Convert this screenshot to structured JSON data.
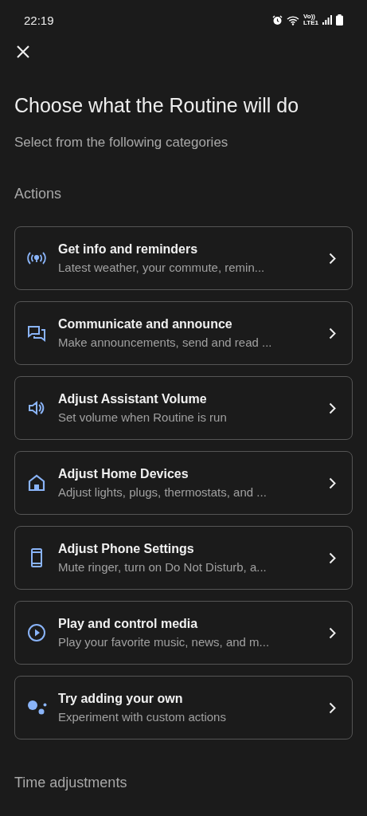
{
  "status_bar": {
    "time": "22:19",
    "network_top": "Vo))",
    "network_bottom": "LTE1"
  },
  "title": "Choose what the Routine will do",
  "subtitle": "Select from the following categories",
  "sections": [
    {
      "heading": "Actions",
      "items": [
        {
          "kind": "info",
          "title": "Get info and reminders",
          "subtitle": "Latest weather, your commute, remin..."
        },
        {
          "kind": "chat",
          "title": "Communicate and announce",
          "subtitle": "Make announcements, send and read ..."
        },
        {
          "kind": "volume",
          "title": "Adjust Assistant Volume",
          "subtitle": "Set volume when Routine is run"
        },
        {
          "kind": "home",
          "title": "Adjust Home Devices",
          "subtitle": "Adjust lights, plugs, thermostats, and ..."
        },
        {
          "kind": "phone",
          "title": "Adjust Phone Settings",
          "subtitle": "Mute ringer, turn on Do Not Disturb, a..."
        },
        {
          "kind": "media",
          "title": "Play and control media",
          "subtitle": "Play your favorite music, news, and m..."
        },
        {
          "kind": "assistant",
          "title": "Try adding your own",
          "subtitle": "Experiment with custom actions"
        }
      ]
    },
    {
      "heading": "Time adjustments"
    }
  ]
}
